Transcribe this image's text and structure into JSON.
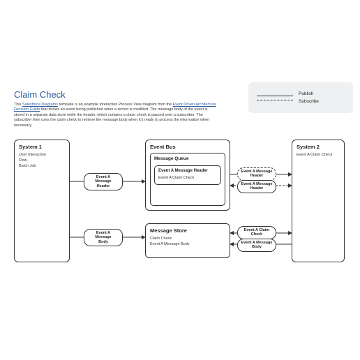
{
  "title": "Claim Check",
  "description_prefix": "This ",
  "link1": "Salesforce Diagrams",
  "description_mid": " template is an example Interaction Process View diagram from the ",
  "link2": "Event Driven Architecture Decision Guide",
  "description_suffix": " that shows an event being published when a record is modified. The message body of the event is stored in a separate data store while the header, which contains a claim check is passed onto a subscriber. The subscriber then uses the claim check to retrieve the message body when it's ready to process the information when necessary.",
  "legend": {
    "publish": "Publish",
    "subscribe": "Subscribe"
  },
  "system1": {
    "title": "System 1",
    "items": [
      "User Interaction",
      "Flow",
      "Batch Job"
    ]
  },
  "eventBus": {
    "title": "Event Bus",
    "queue": {
      "title": "Message Queue",
      "header": {
        "title": "Event A Message Header",
        "item": "Event A Claim Check"
      }
    }
  },
  "messageStore": {
    "title": "Message Store",
    "items": [
      "Claim Check",
      "Event A Message Body"
    ]
  },
  "system2": {
    "title": "System 2",
    "item": "Event A Claim Check"
  },
  "connections": {
    "s1_to_bus": "Event A\nMessage\nHeader",
    "s1_to_store": "Event A\nMessage\nBody",
    "bus_to_s2_pub": "Event A  Message\nHeader",
    "bus_to_s2_sub": "Event A Message\nHeader",
    "store_to_s2_pub": "Event A Claim\nCheck",
    "store_to_s2_sub": "Event A Message\nBody"
  }
}
